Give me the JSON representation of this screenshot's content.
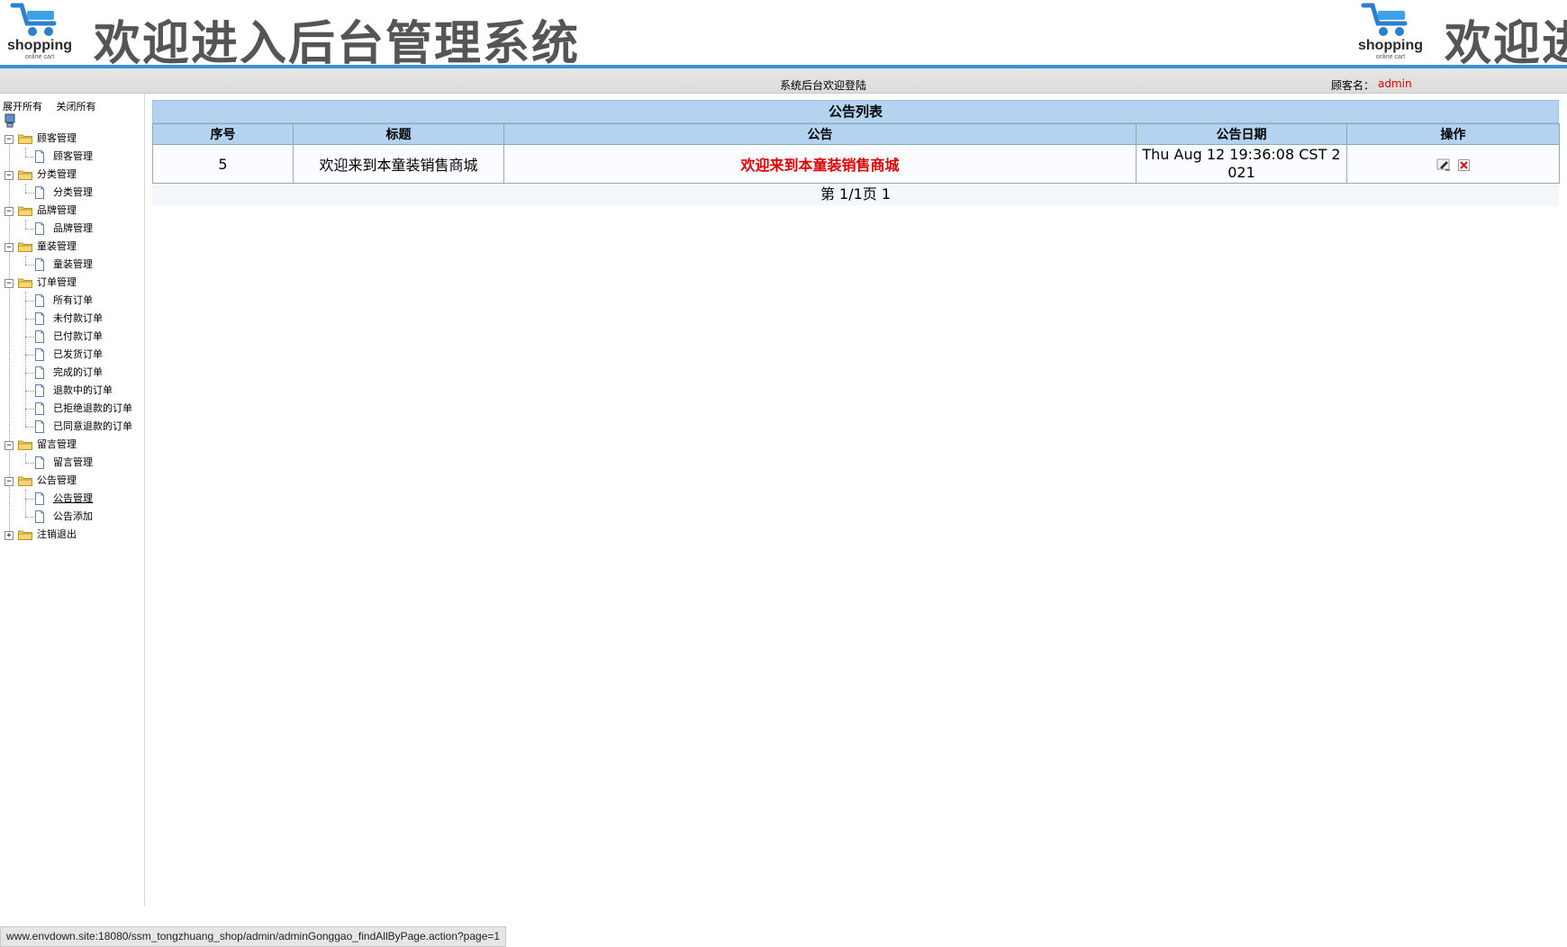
{
  "header": {
    "logo_text": "shopping",
    "logo_sub": "online cart",
    "title": "欢迎进入后台管理系统",
    "title_partial": "欢迎进"
  },
  "topbar": {
    "welcome": "系统后台欢迎登陆",
    "user_label": "顾客名：",
    "user_name": "admin"
  },
  "sidebar": {
    "expand_all": "展开所有",
    "collapse_all": "关闭所有",
    "groups": [
      {
        "label": "顾客管理",
        "items": [
          "顾客管理"
        ]
      },
      {
        "label": "分类管理",
        "items": [
          "分类管理"
        ]
      },
      {
        "label": "品牌管理",
        "items": [
          "品牌管理"
        ]
      },
      {
        "label": "童装管理",
        "items": [
          "童装管理"
        ]
      },
      {
        "label": "订单管理",
        "items": [
          "所有订单",
          "未付款订单",
          "已付款订单",
          "已发货订单",
          "完成的订单",
          "退款中的订单",
          "已拒绝退款的订单",
          "已同意退款的订单"
        ]
      },
      {
        "label": "留言管理",
        "items": [
          "留言管理"
        ]
      },
      {
        "label": "公告管理",
        "items": [
          "公告管理",
          "公告添加"
        ]
      },
      {
        "label": "注销退出",
        "items": []
      }
    ]
  },
  "main": {
    "panel_title": "公告列表",
    "columns": [
      "序号",
      "标题",
      "公告",
      "公告日期",
      "操作"
    ],
    "rows": [
      {
        "id": "5",
        "title": "欢迎来到本童装销售商城",
        "notice": "欢迎来到本童装销售商城",
        "date": "Thu Aug 12 19:36:08 CST 2021"
      }
    ],
    "pager": "第 1/1页 1"
  },
  "statusbar": {
    "url": "www.envdown.site:18080/ssm_tongzhuang_shop/admin/adminGonggao_findAllByPage.action?page=1"
  },
  "colors": {
    "accent_blue": "#3d8fd8",
    "table_header": "#b3d3f0",
    "highlight_red": "#e00000"
  }
}
